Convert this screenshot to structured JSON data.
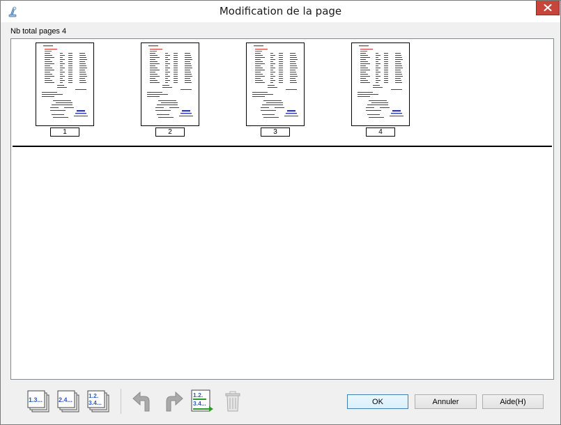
{
  "window": {
    "title": "Modification de la page",
    "close_icon": "close-icon",
    "app_icon": "scanner-icon"
  },
  "pages": {
    "total_label": "Nb total pages 4",
    "thumbnails": [
      {
        "number": "1"
      },
      {
        "number": "2"
      },
      {
        "number": "3"
      },
      {
        "number": "4"
      }
    ]
  },
  "toolbar": {
    "select_odd_icon": "select-odd-pages-icon",
    "select_odd_text": "1.3...",
    "select_even_icon": "select-even-pages-icon",
    "select_even_text": "2.4...",
    "select_all_icon": "select-all-pages-icon",
    "select_all_text_line1": "1.2.",
    "select_all_text_line2": "3.4...",
    "rotate_left_icon": "rotate-left-icon",
    "rotate_right_icon": "rotate-right-icon",
    "reorder_icon": "reorder-pages-icon",
    "reorder_text_line1": "1.2.",
    "reorder_text_line2": "3.4...",
    "delete_icon": "trash-icon"
  },
  "buttons": {
    "ok": "OK",
    "cancel": "Annuler",
    "help": "Aide(H)"
  },
  "colors": {
    "close_button": "#c7453b",
    "accent_blue": "#2a58c8",
    "accent_green": "#2a9a2a"
  }
}
